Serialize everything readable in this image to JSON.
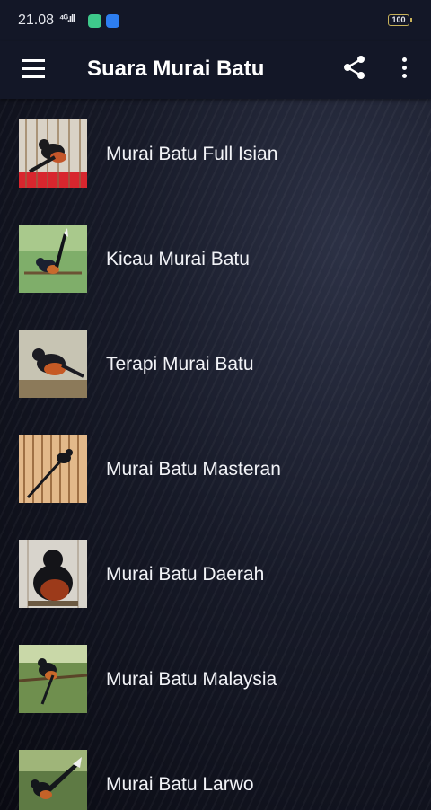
{
  "status_bar": {
    "time": "21.08",
    "signal": "⁴ᴳ.ıll",
    "battery": "100"
  },
  "app_bar": {
    "title": "Suara Murai Batu"
  },
  "icons": {
    "menu": "hamburger-menu-icon",
    "share": "share-icon",
    "more": "more-vertical-icon"
  },
  "colors": {
    "app_bar": "#131727",
    "background": "#0f1220",
    "text": "#f2f3f7"
  },
  "items": [
    {
      "label": "Murai Batu Full Isian",
      "thumb": "bird-in-cage-photo"
    },
    {
      "label": "Kicau Murai Batu",
      "thumb": "bird-on-branch-photo"
    },
    {
      "label": "Terapi Murai Batu",
      "thumb": "bird-on-log-photo"
    },
    {
      "label": "Murai Batu Masteran",
      "thumb": "bird-in-wooden-cage-photo"
    },
    {
      "label": "Murai Batu Daerah",
      "thumb": "bird-closeup-photo"
    },
    {
      "label": "Murai Batu Malaysia",
      "thumb": "bird-in-tree-photo"
    },
    {
      "label": "Murai Batu Larwo",
      "thumb": "bird-tail-up-photo"
    }
  ]
}
